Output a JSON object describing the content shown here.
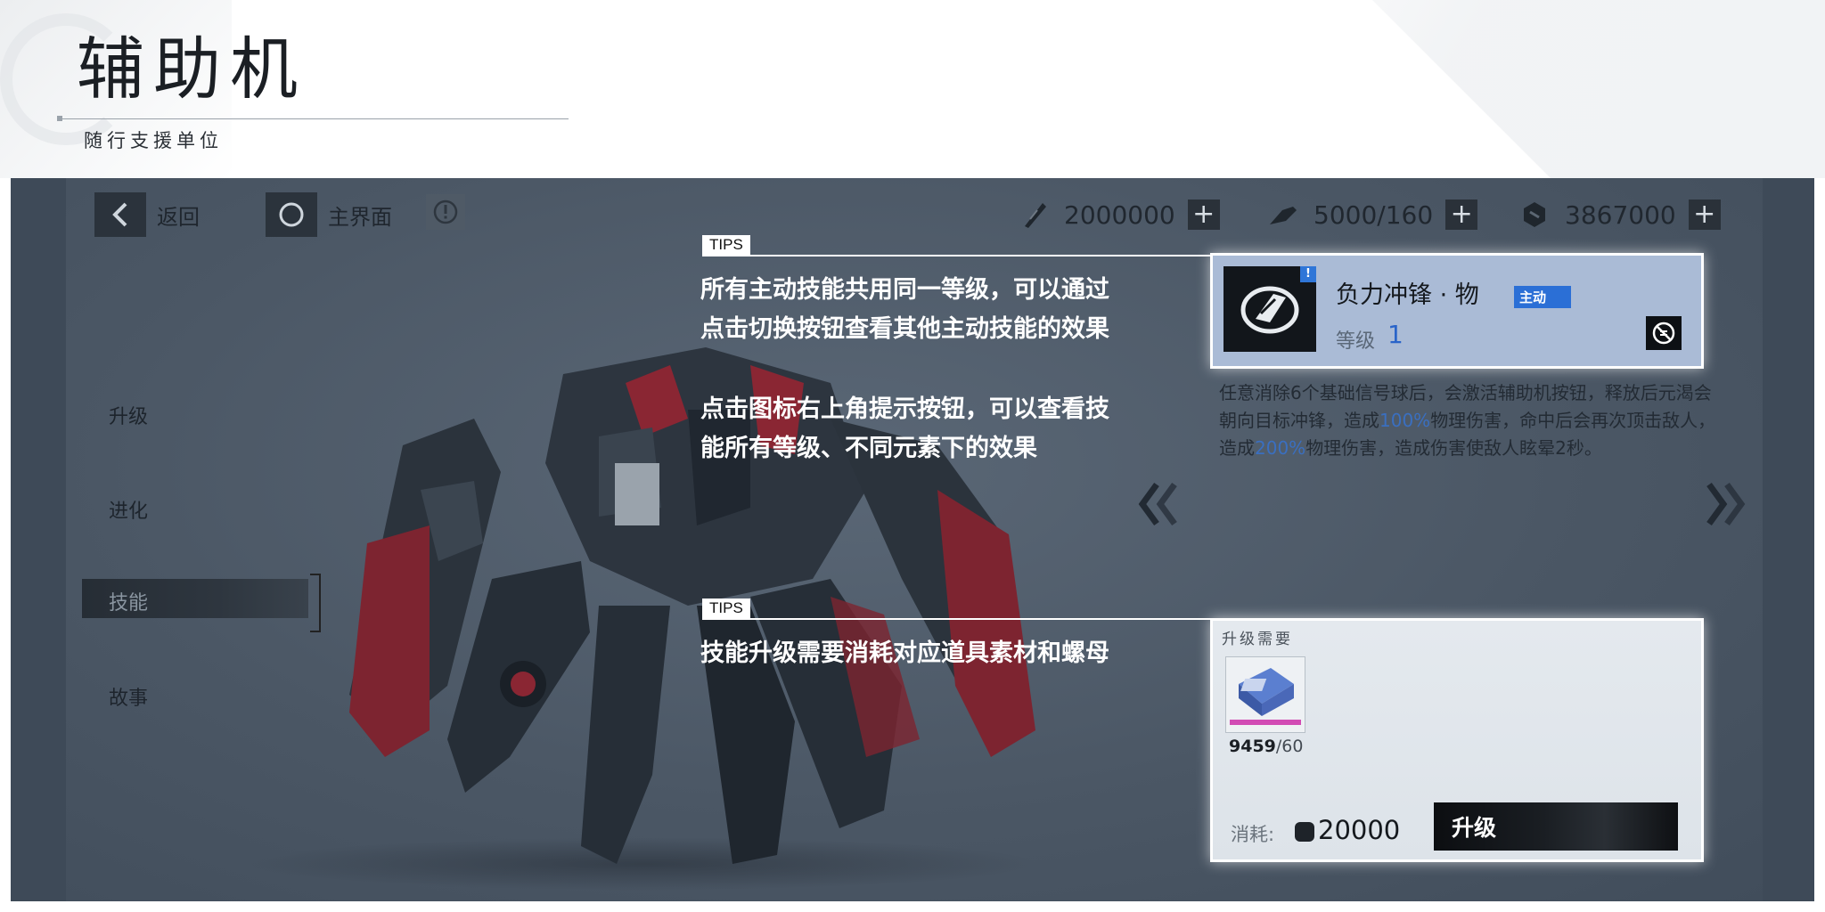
{
  "header": {
    "title": "辅助机",
    "subtitle": "随行支援单位"
  },
  "topbar": {
    "back_label": "返回",
    "home_label": "主界面"
  },
  "resources": [
    {
      "icon": "ticket-icon",
      "value": "2000000"
    },
    {
      "icon": "fuel-icon",
      "value": "5000/160"
    },
    {
      "icon": "coin-icon",
      "value": "3867000"
    }
  ],
  "side_menu": {
    "items": [
      "升级",
      "进化",
      "技能",
      "故事"
    ],
    "active": "技能"
  },
  "tips": [
    {
      "tag": "TIPS",
      "lines": [
        "所有主动技能共用同一等级，可以通过",
        "点击切换按钮查看其他主动技能的效果",
        "点击图标右上角提示按钮，可以查看技",
        "能所有等级、不同元素下的效果"
      ]
    },
    {
      "tag": "TIPS",
      "lines": [
        "技能升级需要消耗对应道具素材和螺母"
      ]
    }
  ],
  "skill": {
    "badge": "!",
    "name": "负力冲锋 · 物",
    "tag": "主动",
    "level_label": "等级",
    "level_value": "1",
    "desc": {
      "part1": "任意消除6个基础信号球后，会激活辅助机按钮，释放后元渴会朝向目标冲锋，造成",
      "pct1": "100%",
      "part2": "物理伤害，命中后会再次顶击敌人，造成",
      "pct2": "200%",
      "part3": "物理伤害，造成伤害使敌人眩晕2秒。"
    }
  },
  "upgrade": {
    "title": "升级需要",
    "item_count": "9459",
    "item_max": "/60",
    "cost_label": "消耗:",
    "cost_value": "20000",
    "button_label": "升级"
  },
  "colors": {
    "panel_bg": "#4b5765",
    "skill_card_bg": "#aabbd6",
    "accent_blue": "#2b6fd6",
    "robot_red": "#8a2633"
  }
}
